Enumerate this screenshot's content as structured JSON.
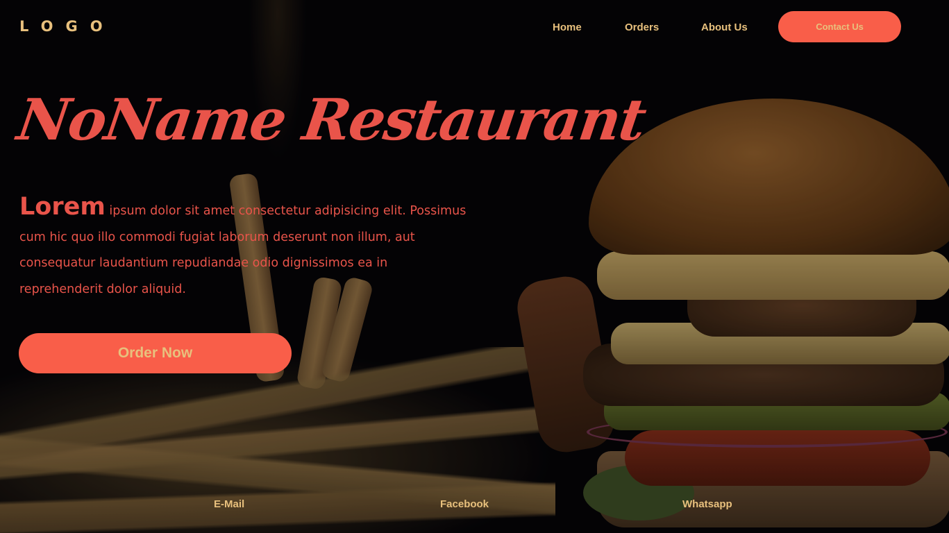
{
  "nav": {
    "logo": "LOGO",
    "links": [
      "Home",
      "Orders",
      "About Us"
    ],
    "contact_label": "Contact Us"
  },
  "hero": {
    "title": "NoName Restaurant",
    "lead_word": "Lorem",
    "description": " ipsum dolor sit amet consectetur adipisicing elit. Possimus cum hic quo illo commodi fugiat laborum deserunt non illum, aut consequatur laudantium repudiandae odio dignissimos ea in reprehenderit dolor aliquid.",
    "order_label": "Order Now"
  },
  "footer": {
    "links": [
      "E-Mail",
      "Facebook",
      "Whatsapp"
    ]
  },
  "colors": {
    "accent": "#f95e49",
    "title_red": "#e9544a",
    "gold": "#e8c07d",
    "background": "#050407"
  }
}
